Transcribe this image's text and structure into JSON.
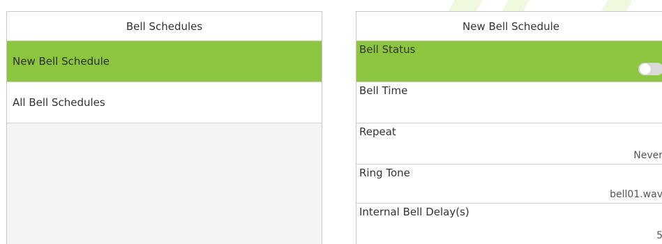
{
  "left_panel": {
    "title": "Bell Schedules",
    "items": [
      {
        "label": "New Bell Schedule",
        "selected": true
      },
      {
        "label": "All Bell Schedules",
        "selected": false
      }
    ]
  },
  "right_panel": {
    "title": "New Bell Schedule",
    "settings": {
      "bell_status": {
        "label": "Bell Status",
        "toggle_on": false
      },
      "bell_time": {
        "label": "Bell Time",
        "value": ""
      },
      "repeat": {
        "label": "Repeat",
        "value": "Never"
      },
      "ring_tone": {
        "label": "Ring Tone",
        "value": "bell01.wav"
      },
      "internal_bell_delay": {
        "label": "Internal Bell Delay(s)",
        "value": "5"
      }
    }
  },
  "colors": {
    "selected_bg": "#8cc63f",
    "border": "#c8c8c8",
    "panel_bg": "#f4f4f4",
    "toggle_off": "#d9d9d9"
  }
}
